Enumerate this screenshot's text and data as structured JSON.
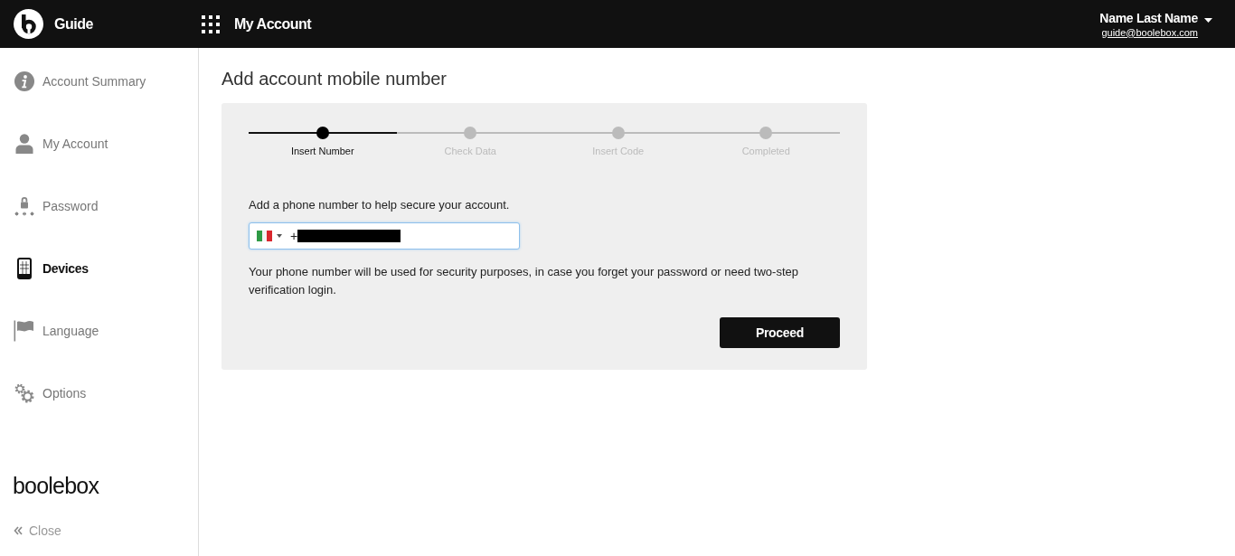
{
  "header": {
    "brand": "Guide",
    "section": "My Account",
    "user": {
      "name": "Name Last Name",
      "email": "guide@boolebox.com"
    }
  },
  "sidebar": {
    "items": [
      {
        "label": "Account Summary",
        "selected": false
      },
      {
        "label": "My Account",
        "selected": false
      },
      {
        "label": "Password",
        "selected": false
      },
      {
        "label": "Devices",
        "selected": true
      },
      {
        "label": "Language",
        "selected": false
      },
      {
        "label": "Options",
        "selected": false
      }
    ],
    "brand": "boolebox",
    "close": "Close"
  },
  "page": {
    "title": "Add account mobile number",
    "steps": [
      {
        "label": "Insert Number",
        "selected": true
      },
      {
        "label": "Check Data",
        "selected": false
      },
      {
        "label": "Insert Code",
        "selected": false
      },
      {
        "label": "Completed",
        "selected": false
      }
    ],
    "prompt": "Add a phone number to help secure your account.",
    "phone_field": {
      "value": "+",
      "redacted": true
    },
    "note": "Your phone number will be used for security purposes, in case you forget your password or need two-step verification login.",
    "button": "Proceed"
  }
}
